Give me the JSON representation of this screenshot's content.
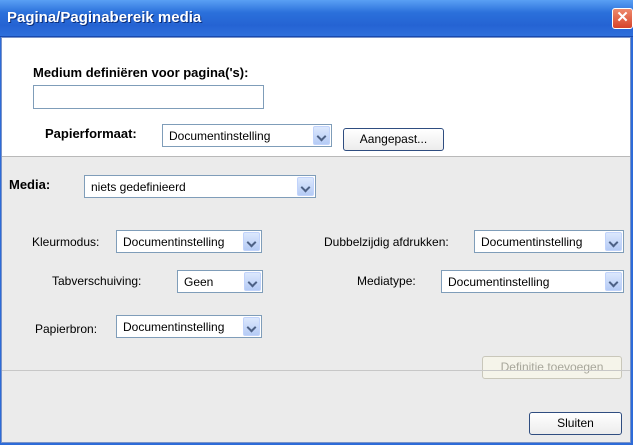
{
  "window": {
    "title": "Pagina/Paginabereik media",
    "close_symbol": "✕"
  },
  "page_range": {
    "label": "Medium definiëren voor pagina('s):",
    "value": ""
  },
  "paper_size": {
    "label": "Papierformaat:",
    "value": "Documentinstelling",
    "custom_button": "Aangepast..."
  },
  "media": {
    "label": "Media:",
    "value": "niets gedefinieerd"
  },
  "settings": {
    "color_mode": {
      "label": "Kleurmodus:",
      "value": "Documentinstelling"
    },
    "duplex": {
      "label": "Dubbelzijdig afdrukken:",
      "value": "Documentinstelling"
    },
    "tab_shift": {
      "label": "Tabverschuiving:",
      "value": "Geen"
    },
    "media_type": {
      "label": "Mediatype:",
      "value": "Documentinstelling"
    },
    "paper_source": {
      "label": "Papierbron:",
      "value": "Documentinstelling"
    }
  },
  "buttons": {
    "add_definition": "Definitie toevoegen",
    "close": "Sluiten"
  }
}
